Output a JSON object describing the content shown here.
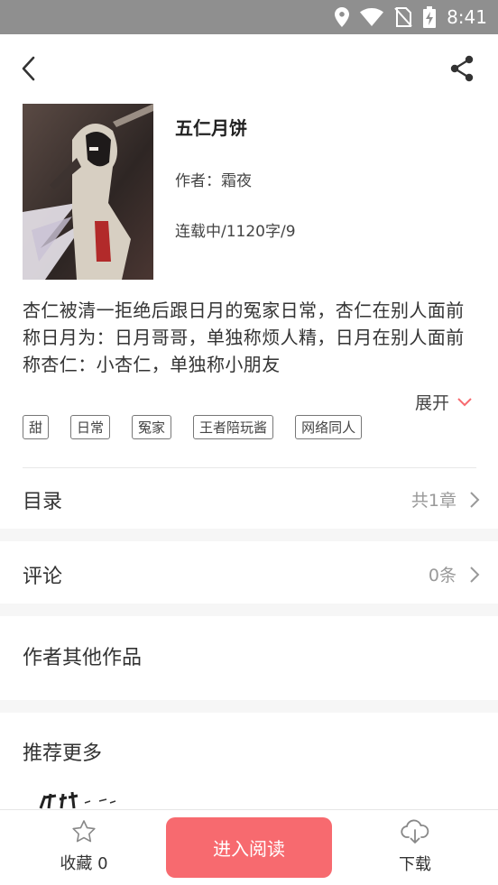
{
  "status_bar": {
    "time": "8:41"
  },
  "book": {
    "title": "五仁月饼",
    "author": "作者：霜夜",
    "status": "连载中/1120字/9",
    "summary": "杏仁被清一拒绝后跟日月的冤家日常，杏仁在别人面前称日月为：日月哥哥，单独称烦人精，日月在别人面前称杏仁：小杏仁，单独称小朋友",
    "expand_label": "展开",
    "tags": [
      "甜",
      "日常",
      "冤家",
      "王者陪玩酱",
      "网络同人"
    ]
  },
  "sections": {
    "catalog": {
      "label": "目录",
      "count": "共1章"
    },
    "comments": {
      "label": "评论",
      "count": "0条"
    },
    "other_works": {
      "label": "作者其他作品"
    },
    "recommend": {
      "label": "推荐更多"
    }
  },
  "bottom_bar": {
    "favorite_label": "收藏 0",
    "read_label": "进入阅读",
    "download_label": "下载"
  },
  "colors": {
    "accent": "#f76a6f",
    "status_bar": "#8f8f8f",
    "band": "#f6f6f6"
  },
  "icons": [
    "back-arrow-icon",
    "share-icon",
    "chevron-down-icon",
    "chevron-right-icon",
    "star-icon",
    "cloud-download-icon",
    "location-icon",
    "wifi-icon",
    "no-sim-icon",
    "battery-charging-icon"
  ]
}
